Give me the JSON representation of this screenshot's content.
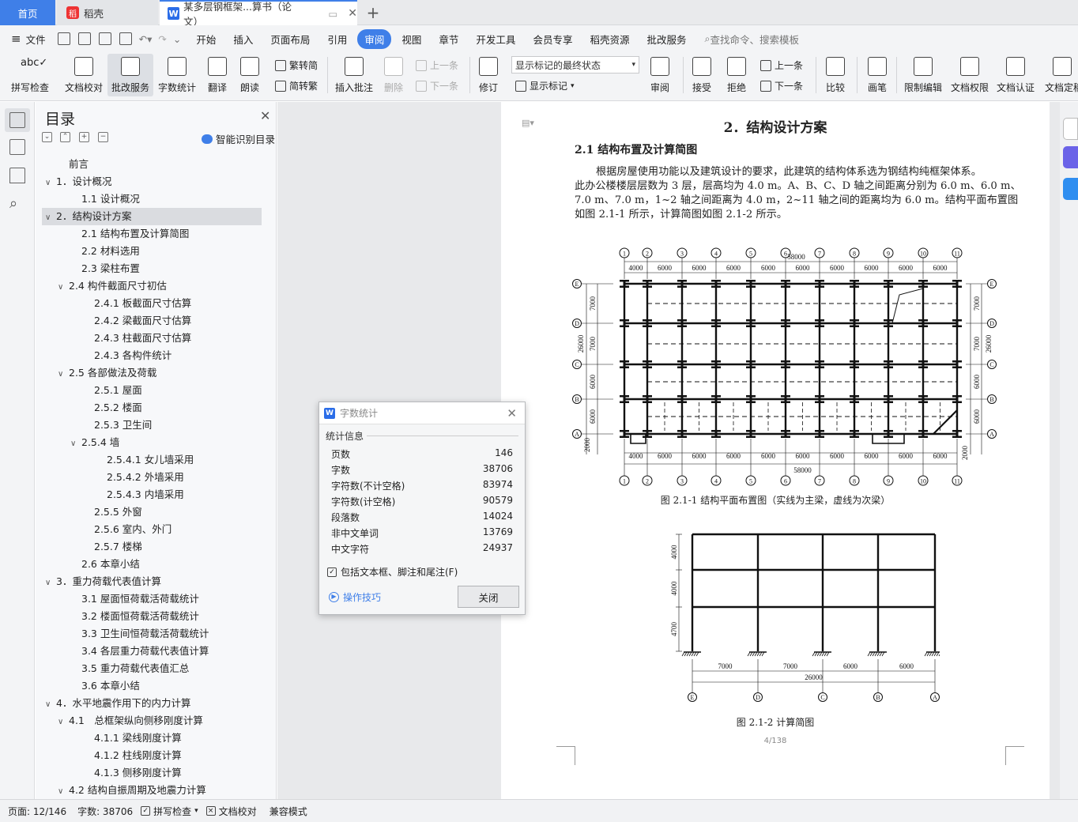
{
  "tabs": {
    "home": "首页",
    "docer": "稻壳",
    "doc": "某多层钢框架...算书（论文）"
  },
  "menu": {
    "file": "文件",
    "items": [
      "开始",
      "插入",
      "页面布局",
      "引用",
      "审阅",
      "视图",
      "章节",
      "开发工具",
      "会员专享",
      "稻壳资源",
      "批改服务"
    ],
    "active_index": 4,
    "search": "查找命令、搜索模板"
  },
  "ribbon": {
    "spell": "拼写检查",
    "proof": "文档校对",
    "review_service": "批改服务",
    "word_count": "字数统计",
    "translate": "翻译",
    "read_aloud": "朗读",
    "trad": "繁转简",
    "simp": "简转繁",
    "insert_comment": "插入批注",
    "delete": "删除",
    "prev": "上一条",
    "next": "下一条",
    "track": "修订",
    "markup_select": "显示标记的最终状态",
    "show_markup": "显示标记",
    "review": "审阅",
    "accept": "接受",
    "reject": "拒绝",
    "prev2": "上一条",
    "next2": "下一条",
    "compare": "比较",
    "pen": "画笔",
    "restrict": "限制编辑",
    "permission": "文档权限",
    "certify": "文档认证",
    "finalize": "文档定稿"
  },
  "toc": {
    "title": "目录",
    "smart": "智能识别目录",
    "items": [
      {
        "t": "前言",
        "l": 1,
        "a": ""
      },
      {
        "t": "1．设计概况",
        "l": 0,
        "a": "v"
      },
      {
        "t": "1.1 设计概况",
        "l": 2,
        "a": ""
      },
      {
        "t": "2．结构设计方案",
        "l": 0,
        "a": "v",
        "sel": true
      },
      {
        "t": "2.1 结构布置及计算简图",
        "l": 2,
        "a": ""
      },
      {
        "t": "2.2 材料选用",
        "l": 2,
        "a": ""
      },
      {
        "t": "2.3 梁柱布置",
        "l": 2,
        "a": ""
      },
      {
        "t": "2.4 构件截面尺寸初估",
        "l": 1,
        "a": "v"
      },
      {
        "t": "2.4.1 板截面尺寸估算",
        "l": 3,
        "a": ""
      },
      {
        "t": "2.4.2 梁截面尺寸估算",
        "l": 3,
        "a": ""
      },
      {
        "t": "2.4.3 柱截面尺寸估算",
        "l": 3,
        "a": ""
      },
      {
        "t": "2.4.3 各构件统计",
        "l": 3,
        "a": ""
      },
      {
        "t": "2.5 各部做法及荷载",
        "l": 1,
        "a": "v"
      },
      {
        "t": "2.5.1 屋面",
        "l": 3,
        "a": ""
      },
      {
        "t": "2.5.2 楼面",
        "l": 3,
        "a": ""
      },
      {
        "t": "2.5.3 卫生间",
        "l": 3,
        "a": ""
      },
      {
        "t": "2.5.4 墙",
        "l": 2.5,
        "a": "v"
      },
      {
        "t": "2.5.4.1 女儿墙采用",
        "l": 4,
        "a": ""
      },
      {
        "t": "2.5.4.2 外墙采用",
        "l": 4,
        "a": ""
      },
      {
        "t": "2.5.4.3 内墙采用",
        "l": 4,
        "a": ""
      },
      {
        "t": "2.5.5 外窗",
        "l": 3,
        "a": ""
      },
      {
        "t": "2.5.6 室内、外门",
        "l": 3,
        "a": ""
      },
      {
        "t": "2.5.7 楼梯",
        "l": 3,
        "a": ""
      },
      {
        "t": "2.6 本章小结",
        "l": 2,
        "a": ""
      },
      {
        "t": "3．重力荷载代表值计算",
        "l": 0,
        "a": "v"
      },
      {
        "t": "3.1 屋面恒荷载活荷载统计",
        "l": 2,
        "a": ""
      },
      {
        "t": "3.2 楼面恒荷载活荷载统计",
        "l": 2,
        "a": ""
      },
      {
        "t": "3.3 卫生间恒荷载活荷载统计",
        "l": 2,
        "a": ""
      },
      {
        "t": "3.4 各层重力荷载代表值计算",
        "l": 2,
        "a": ""
      },
      {
        "t": "3.5 重力荷载代表值汇总",
        "l": 2,
        "a": ""
      },
      {
        "t": "3.6 本章小结",
        "l": 2,
        "a": ""
      },
      {
        "t": "4．水平地震作用下的内力计算",
        "l": 0,
        "a": "v"
      },
      {
        "t": "4.1　总框架纵向侧移刚度计算",
        "l": 1,
        "a": "v"
      },
      {
        "t": "4.1.1 梁线刚度计算",
        "l": 3,
        "a": ""
      },
      {
        "t": "4.1.2 柱线刚度计算",
        "l": 3,
        "a": ""
      },
      {
        "t": "4.1.3 侧移刚度计算",
        "l": 3,
        "a": ""
      },
      {
        "t": "4.2 结构自振周期及地震力计算",
        "l": 1,
        "a": "v"
      }
    ]
  },
  "doc": {
    "chapter": "2．结构设计方案",
    "section": "2.1 结构布置及计算简图",
    "para1": "根据房屋使用功能以及建筑设计的要求，此建筑的结构体系选为钢结构纯框架体系。",
    "para2": "此办公楼楼层层数为 3 层，层高均为 4.0 m。A、B、C、D 轴之间距离分别为 6.0 m、6.0 m、",
    "para3": "7.0 m、7.0 m，1~2 轴之间距离为 4.0 m，2~11 轴之间的距离均为 6.0 m。结构平面布置图",
    "para4": "如图 2.1-1 所示，计算简图如图 2.1-2 所示。",
    "fig1_caption": "图 2.1-1 结构平面布置图（实线为主梁，虚线为次梁）",
    "fig2_caption": "图 2.1-2 计算简图",
    "page_num": "4/138",
    "plan": {
      "top_dims": [
        "4000",
        "6000",
        "6000",
        "6000",
        "6000",
        "6000",
        "6000",
        "6000",
        "6000",
        "6000"
      ],
      "total": "58000",
      "axes": [
        "1",
        "2",
        "3",
        "4",
        "5",
        "6",
        "7",
        "8",
        "9",
        "10",
        "11"
      ],
      "rows": [
        "E",
        "D",
        "C",
        "B",
        "A"
      ],
      "left_dims": [
        "7000",
        "7000",
        "6000",
        "6000"
      ],
      "right_dims": [
        "7000",
        "7000",
        "6000",
        "6000"
      ],
      "side_total": "26000",
      "overhang": "2000"
    },
    "frame": {
      "heights": [
        "4000",
        "4000",
        "4700"
      ],
      "spans": [
        "7000",
        "7000",
        "6000",
        "6000"
      ],
      "total": "26000",
      "axes": [
        "E",
        "D",
        "C",
        "B",
        "A"
      ]
    }
  },
  "dialog": {
    "title": "字数统计",
    "section": "统计信息",
    "rows": [
      [
        "页数",
        "146"
      ],
      [
        "字数",
        "38706"
      ],
      [
        "字符数(不计空格)",
        "83974"
      ],
      [
        "字符数(计空格)",
        "90579"
      ],
      [
        "段落数",
        "14024"
      ],
      [
        "非中文单词",
        "13769"
      ],
      [
        "中文字符",
        "24937"
      ]
    ],
    "include": "包括文本框、脚注和尾注(F)",
    "tips": "操作技巧",
    "close": "关闭"
  },
  "status": {
    "page": "页面: 12/146",
    "words": "字数: 38706",
    "spell": "拼写检查",
    "proof": "文档校对",
    "compat": "兼容模式"
  }
}
